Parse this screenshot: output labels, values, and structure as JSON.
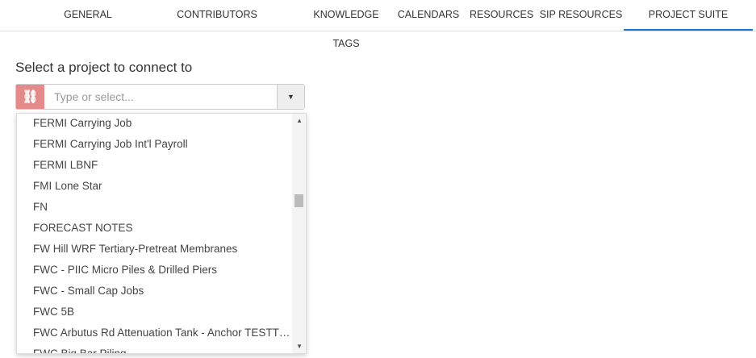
{
  "tabs": [
    {
      "label": "GENERAL"
    },
    {
      "label": "CONTRIBUTORS"
    },
    {
      "label": "KNOWLEDGE TAGS"
    },
    {
      "label": "CALENDARS"
    },
    {
      "label": "RESOURCES"
    },
    {
      "label": "SIP RESOURCES"
    },
    {
      "label": "PROJECT SUITE",
      "active": true
    }
  ],
  "form": {
    "label": "Select a project to connect to",
    "placeholder": "Type or select...",
    "value": ""
  },
  "options": [
    "FERMI Carrying Job",
    "FERMI Carrying Job Int'l Payroll",
    "FERMI LBNF",
    "FMI Lone Star",
    "FN",
    "FORECAST NOTES",
    "FW Hill WRF Tertiary-Pretreat Membranes",
    "FWC - PIIC Micro Piles & Drilled Piers",
    "FWC - Small Cap Jobs",
    "FWC 5B",
    "FWC Arbutus Rd Attenuation Tank - Anchor TESTT…",
    "FWC Big Bar Piling"
  ],
  "scroll_position": 0.35
}
